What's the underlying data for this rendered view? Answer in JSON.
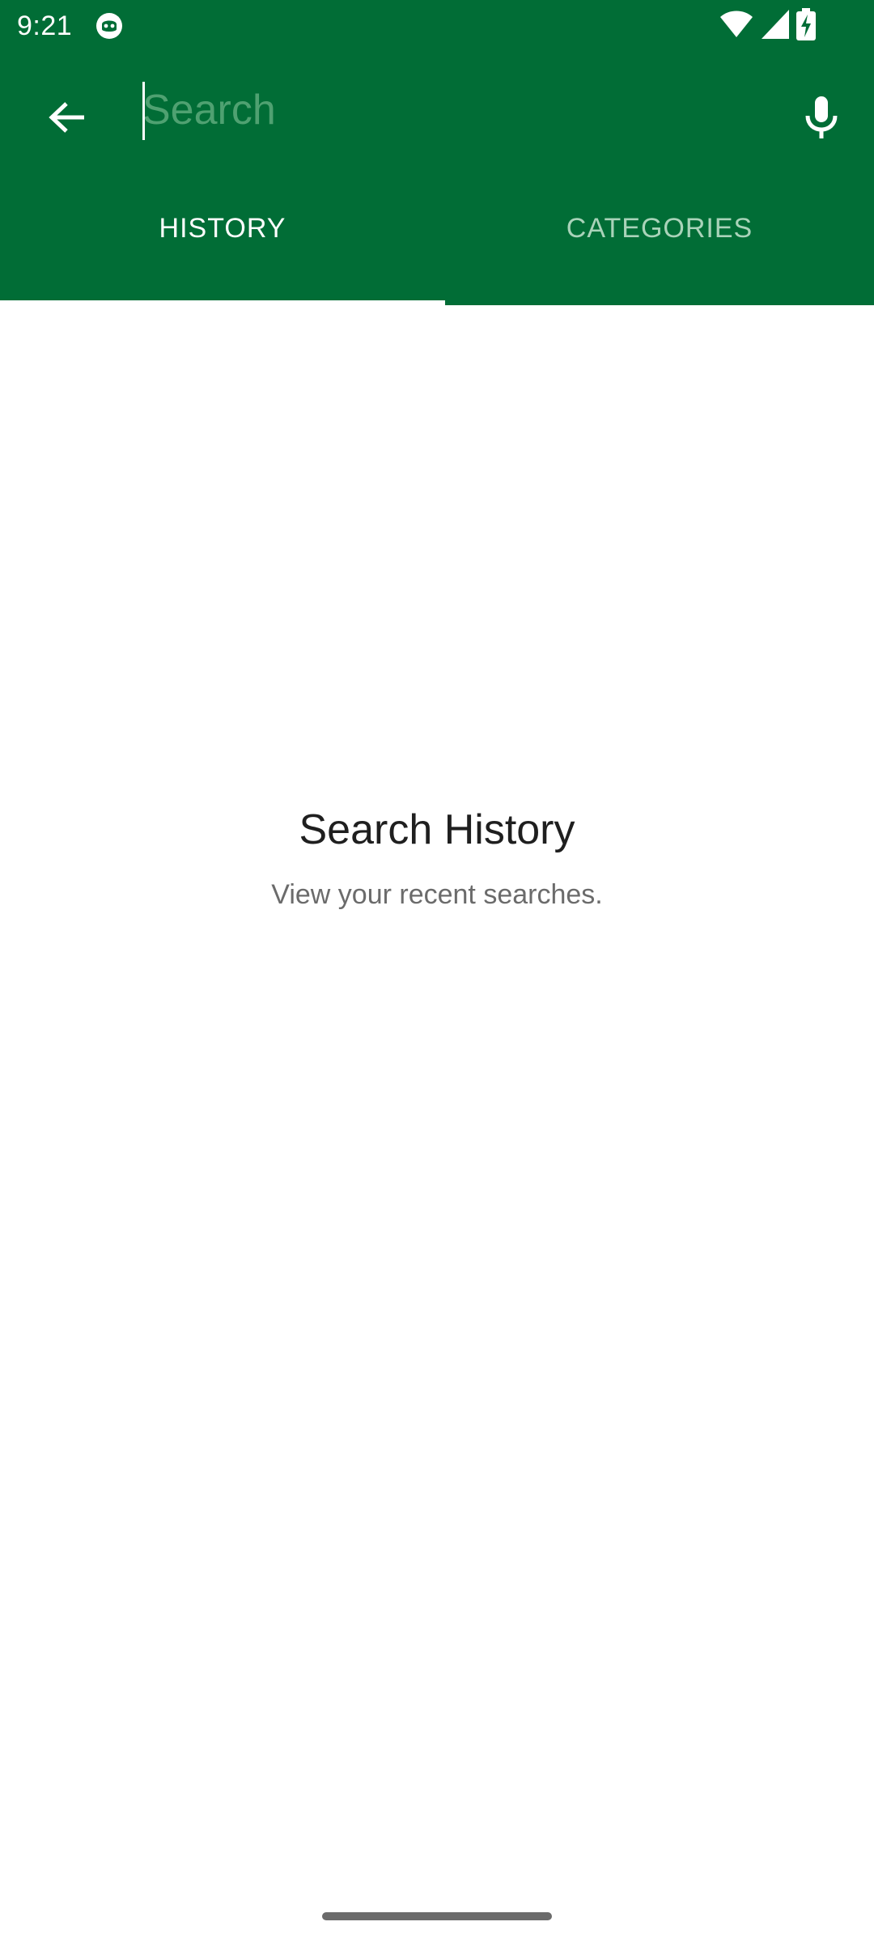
{
  "status_bar": {
    "time": "9:21",
    "icons": [
      "app-notification-icon",
      "wifi-icon",
      "signal-icon",
      "battery-charging-icon"
    ]
  },
  "toolbar": {
    "back_icon": "arrow-back-icon",
    "search_placeholder": "Search",
    "search_value": "",
    "mic_icon": "microphone-icon"
  },
  "tabs": [
    {
      "label": "HISTORY",
      "selected": true
    },
    {
      "label": "CATEGORIES",
      "selected": false
    }
  ],
  "empty_state": {
    "title": "Search History",
    "subtitle": "View your recent searches."
  },
  "colors": {
    "app_bar": "#016d36",
    "tab_inactive_text": "#a9d3b9",
    "placeholder": "#4fa171",
    "title_text": "#1f1f1f",
    "subtitle_text": "#6b6b6b"
  }
}
